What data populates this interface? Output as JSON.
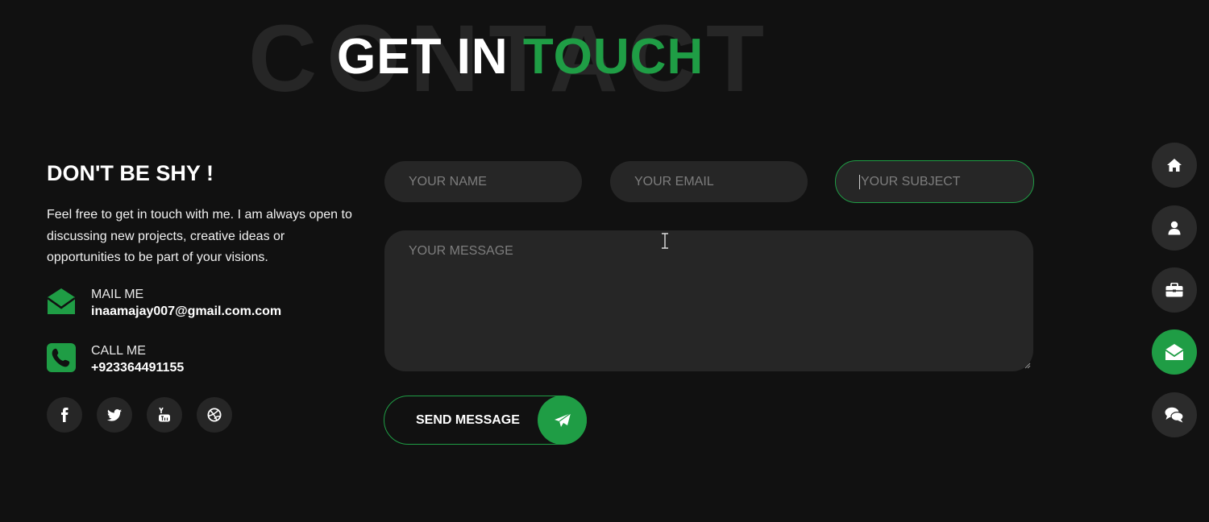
{
  "header": {
    "background_word": "CONTACT",
    "title_part1": "GET IN",
    "title_part2": "TOUCH"
  },
  "intro": {
    "heading": "DON'T BE SHY !",
    "text": "Feel free to get in touch with me. I am always open to discussing new projects, creative ideas or opportunities to be part of your visions."
  },
  "contacts": [
    {
      "label": "MAIL ME",
      "value": "inaamajay007@gmail.com.com",
      "icon": "envelope-open-icon"
    },
    {
      "label": "CALL ME",
      "value": "+923364491155",
      "icon": "phone-icon"
    }
  ],
  "socials": [
    {
      "icon": "facebook-icon"
    },
    {
      "icon": "twitter-icon"
    },
    {
      "icon": "youtube-icon"
    },
    {
      "icon": "dribbble-icon"
    }
  ],
  "form": {
    "name_placeholder": "YOUR NAME",
    "email_placeholder": "YOUR EMAIL",
    "subject_placeholder": "YOUR SUBJECT",
    "message_placeholder": "YOUR MESSAGE",
    "send_label": "SEND MESSAGE"
  },
  "nav": [
    {
      "icon": "home-icon",
      "active": false
    },
    {
      "icon": "user-icon",
      "active": false
    },
    {
      "icon": "briefcase-icon",
      "active": false
    },
    {
      "icon": "envelope-open-icon",
      "active": true
    },
    {
      "icon": "comments-icon",
      "active": false
    }
  ],
  "colors": {
    "accent": "#1f9d45",
    "background": "#111111",
    "field": "#262626",
    "placeholder": "#7d7d7d"
  }
}
